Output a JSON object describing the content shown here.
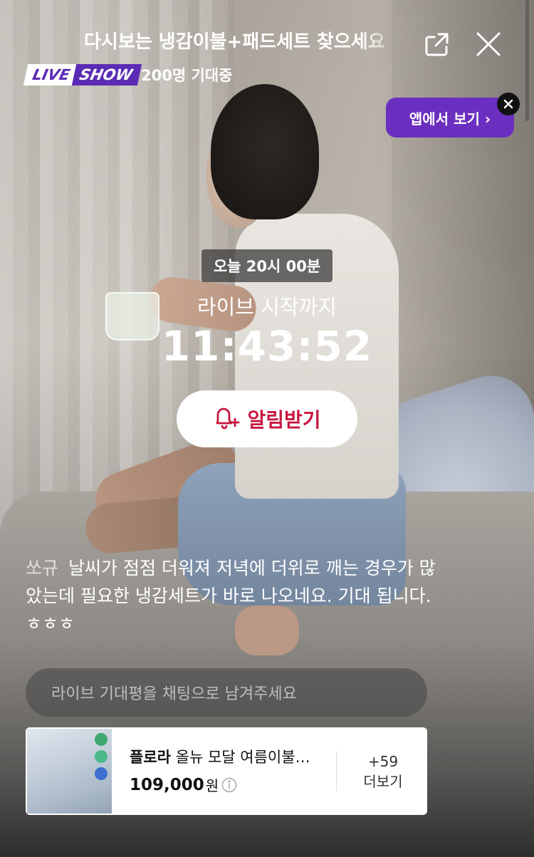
{
  "header": {
    "title": "다시보는 냉감이불+패드세트 찾으세요",
    "badge_live": "LIVE",
    "badge_show": "SHOW",
    "viewers": "200명 기대중"
  },
  "app_banner": {
    "label": "앱에서 보기 ›"
  },
  "countdown": {
    "date_chip": "오늘 20시 00분",
    "until_label": "라이브 시작까지",
    "timer": "11:43:52",
    "alarm_label": "알림받기"
  },
  "comment": {
    "user": "쏘규",
    "text": "날씨가 점점 더워져 저녁에 더위로 깨는 경우가 많았는데 필요한 냉감세트가 바로 나오네요. 기대 됩니다.ㅎㅎㅎ"
  },
  "chat": {
    "placeholder": "라이브 기대평을 채팅으로 남겨주세요"
  },
  "product": {
    "brand": "플로라",
    "name": "올뉴 모달 여름이불+...",
    "price": "109,000",
    "currency": "원",
    "more_count": "+59",
    "more_label": "더보기"
  },
  "colors": {
    "accent_purple": "#6b2fc0",
    "alarm_red": "#c8173f"
  }
}
